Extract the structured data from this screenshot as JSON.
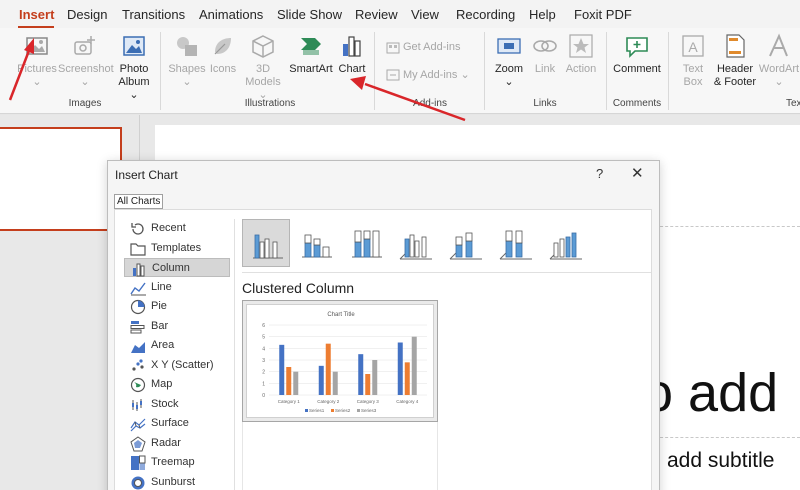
{
  "ribbon_tabs": [
    "Insert",
    "Design",
    "Transitions",
    "Animations",
    "Slide Show",
    "Review",
    "View",
    "Recording",
    "Help",
    "Foxit PDF"
  ],
  "groups": {
    "images": {
      "label": "Images",
      "pictures": "Pictures",
      "screenshot": "Screenshot",
      "photo_album_line1": "Photo",
      "photo_album_line2": "Album"
    },
    "illustrations": {
      "label": "Illustrations",
      "shapes": "Shapes",
      "icons": "Icons",
      "models_line1": "3D",
      "models_line2": "Models",
      "smartart": "SmartArt",
      "chart": "Chart"
    },
    "addins": {
      "label": "Add-ins",
      "get_addins": "Get Add-ins",
      "my_addins": "My Add-ins"
    },
    "links": {
      "label": "Links",
      "zoom": "Zoom",
      "link": "Link",
      "action": "Action"
    },
    "comments": {
      "label": "Comments",
      "comment": "Comment"
    },
    "text": {
      "label": "Tex",
      "textbox_line1": "Text",
      "textbox_line2": "Box",
      "header_line1": "Header",
      "header_line2": "& Footer",
      "wordart": "WordArt"
    }
  },
  "slide": {
    "title_fragment": "o add",
    "subtitle_fragment": "add subtitle"
  },
  "dialog": {
    "title": "Insert Chart",
    "help": "?",
    "close": "✕",
    "tab": "All Charts",
    "chart_types": [
      "Recent",
      "Templates",
      "Column",
      "Line",
      "Pie",
      "Bar",
      "Area",
      "X Y (Scatter)",
      "Map",
      "Stock",
      "Surface",
      "Radar",
      "Treemap",
      "Sunburst"
    ],
    "selected_type": "Column",
    "subtypes": [
      "clustered-column",
      "stacked-column",
      "100-stacked-column",
      "3d-clustered-column",
      "3d-stacked-column",
      "3d-100-stacked-column",
      "3d-column"
    ],
    "preview_title": "Clustered Column"
  },
  "colors": {
    "accent": "#c43e1c",
    "series1": "#4472c4",
    "series2": "#ed7d31",
    "series3": "#a5a5a5",
    "arrow": "#d9262a"
  },
  "chart_data": {
    "type": "bar",
    "title": "Chart Title",
    "categories": [
      "Category 1",
      "Category 2",
      "Category 3",
      "Category 4"
    ],
    "series": [
      {
        "name": "Series1",
        "values": [
          4.3,
          2.5,
          3.5,
          4.5
        ]
      },
      {
        "name": "Series2",
        "values": [
          2.4,
          4.4,
          1.8,
          2.8
        ]
      },
      {
        "name": "Series3",
        "values": [
          2,
          2,
          3,
          5
        ]
      }
    ],
    "ylim": [
      0,
      6
    ],
    "yticks": [
      "0",
      "1",
      "2",
      "3",
      "4",
      "5",
      "6"
    ],
    "grid": true,
    "legend": "bottom"
  }
}
